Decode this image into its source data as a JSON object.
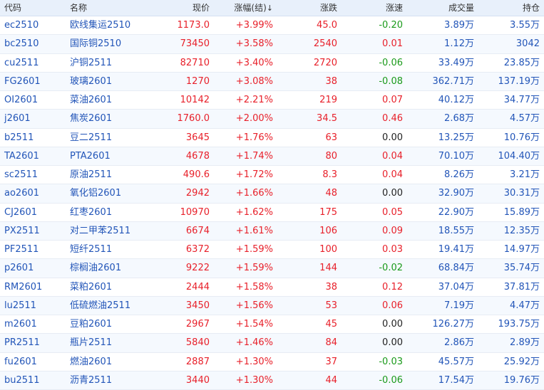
{
  "header": {
    "code": "代码",
    "name": "名称",
    "price": "现价",
    "pct": "涨幅(结)",
    "sort_arrow": "↓",
    "chg": "涨跌",
    "speed": "涨速",
    "volume": "成交量",
    "oi": "持仓"
  },
  "colors": {
    "up": "#e8202a",
    "down": "#1a9a1a",
    "link": "#2255b8",
    "header_bg": "#e8f0fb"
  },
  "rows": [
    {
      "code": "ec2510",
      "name": "欧线集运2510",
      "price": "1173.0",
      "pct": "+3.99%",
      "chg": "45.0",
      "speed": "-0.20",
      "speed_dir": "down",
      "volume": "3.89万",
      "oi": "3.55万"
    },
    {
      "code": "bc2510",
      "name": "国际铜2510",
      "price": "73450",
      "pct": "+3.58%",
      "chg": "2540",
      "speed": "0.01",
      "speed_dir": "up",
      "volume": "1.12万",
      "oi": "3042"
    },
    {
      "code": "cu2511",
      "name": "沪铜2511",
      "price": "82710",
      "pct": "+3.40%",
      "chg": "2720",
      "speed": "-0.06",
      "speed_dir": "down",
      "volume": "33.49万",
      "oi": "23.85万"
    },
    {
      "code": "FG2601",
      "name": "玻璃2601",
      "price": "1270",
      "pct": "+3.08%",
      "chg": "38",
      "speed": "-0.08",
      "speed_dir": "down",
      "volume": "362.71万",
      "oi": "137.19万"
    },
    {
      "code": "OI2601",
      "name": "菜油2601",
      "price": "10142",
      "pct": "+2.21%",
      "chg": "219",
      "speed": "0.07",
      "speed_dir": "up",
      "volume": "40.12万",
      "oi": "34.77万"
    },
    {
      "code": "j2601",
      "name": "焦炭2601",
      "price": "1760.0",
      "pct": "+2.00%",
      "chg": "34.5",
      "speed": "0.46",
      "speed_dir": "up",
      "volume": "2.68万",
      "oi": "4.57万"
    },
    {
      "code": "b2511",
      "name": "豆二2511",
      "price": "3645",
      "pct": "+1.76%",
      "chg": "63",
      "speed": "0.00",
      "speed_dir": "flat",
      "volume": "13.25万",
      "oi": "10.76万"
    },
    {
      "code": "TA2601",
      "name": "PTA2601",
      "price": "4678",
      "pct": "+1.74%",
      "chg": "80",
      "speed": "0.04",
      "speed_dir": "up",
      "volume": "70.10万",
      "oi": "104.40万"
    },
    {
      "code": "sc2511",
      "name": "原油2511",
      "price": "490.6",
      "pct": "+1.72%",
      "chg": "8.3",
      "speed": "0.04",
      "speed_dir": "up",
      "volume": "8.26万",
      "oi": "3.21万"
    },
    {
      "code": "ao2601",
      "name": "氧化铝2601",
      "price": "2942",
      "pct": "+1.66%",
      "chg": "48",
      "speed": "0.00",
      "speed_dir": "flat",
      "volume": "32.90万",
      "oi": "30.31万"
    },
    {
      "code": "CJ2601",
      "name": "红枣2601",
      "price": "10970",
      "pct": "+1.62%",
      "chg": "175",
      "speed": "0.05",
      "speed_dir": "up",
      "volume": "22.90万",
      "oi": "15.89万"
    },
    {
      "code": "PX2511",
      "name": "对二甲苯2511",
      "price": "6674",
      "pct": "+1.61%",
      "chg": "106",
      "speed": "0.09",
      "speed_dir": "up",
      "volume": "18.55万",
      "oi": "12.35万"
    },
    {
      "code": "PF2511",
      "name": "短纤2511",
      "price": "6372",
      "pct": "+1.59%",
      "chg": "100",
      "speed": "0.03",
      "speed_dir": "up",
      "volume": "19.41万",
      "oi": "14.97万"
    },
    {
      "code": "p2601",
      "name": "棕榈油2601",
      "price": "9222",
      "pct": "+1.59%",
      "chg": "144",
      "speed": "-0.02",
      "speed_dir": "down",
      "volume": "68.84万",
      "oi": "35.74万"
    },
    {
      "code": "RM2601",
      "name": "菜粕2601",
      "price": "2444",
      "pct": "+1.58%",
      "chg": "38",
      "speed": "0.12",
      "speed_dir": "up",
      "volume": "37.04万",
      "oi": "37.81万"
    },
    {
      "code": "lu2511",
      "name": "低硫燃油2511",
      "price": "3450",
      "pct": "+1.56%",
      "chg": "53",
      "speed": "0.06",
      "speed_dir": "up",
      "volume": "7.19万",
      "oi": "4.47万"
    },
    {
      "code": "m2601",
      "name": "豆粕2601",
      "price": "2967",
      "pct": "+1.54%",
      "chg": "45",
      "speed": "0.00",
      "speed_dir": "flat",
      "volume": "126.27万",
      "oi": "193.75万"
    },
    {
      "code": "PR2511",
      "name": "瓶片2511",
      "price": "5840",
      "pct": "+1.46%",
      "chg": "84",
      "speed": "0.00",
      "speed_dir": "flat",
      "volume": "2.86万",
      "oi": "2.89万"
    },
    {
      "code": "fu2601",
      "name": "燃油2601",
      "price": "2887",
      "pct": "+1.30%",
      "chg": "37",
      "speed": "-0.03",
      "speed_dir": "down",
      "volume": "45.57万",
      "oi": "25.92万"
    },
    {
      "code": "bu2511",
      "name": "沥青2511",
      "price": "3440",
      "pct": "+1.30%",
      "chg": "44",
      "speed": "-0.06",
      "speed_dir": "down",
      "volume": "17.54万",
      "oi": "19.76万"
    }
  ]
}
